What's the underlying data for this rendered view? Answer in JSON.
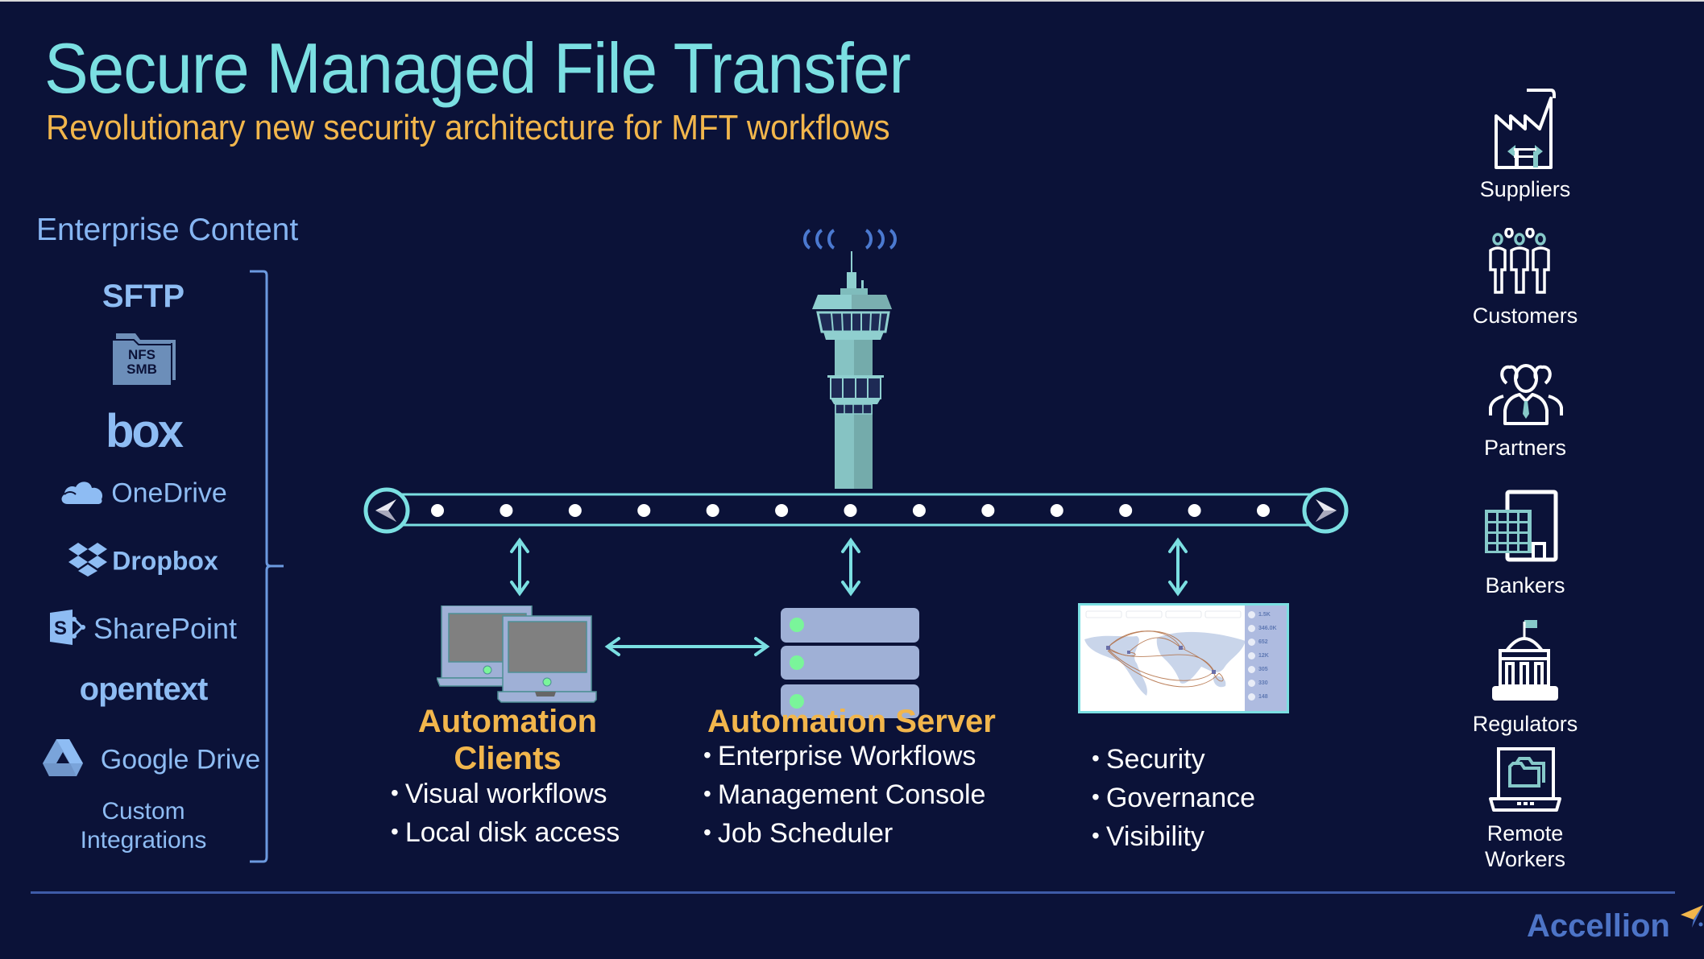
{
  "header": {
    "title": "Secure Managed File Transfer",
    "subtitle": "Revolutionary new security architecture for MFT workflows"
  },
  "enterprise_content": {
    "heading": "Enterprise Content",
    "items": [
      {
        "label": "SFTP",
        "icon": "text-logo"
      },
      {
        "label": "NFS\nSMB",
        "line1": "NFS",
        "line2": "SMB",
        "icon": "folder-icon"
      },
      {
        "label": "box",
        "icon": "box-logo"
      },
      {
        "label": "OneDrive",
        "icon": "cloud-icon"
      },
      {
        "label": "Dropbox",
        "icon": "dropbox-icon"
      },
      {
        "label": "SharePoint",
        "icon": "sharepoint-icon"
      },
      {
        "label": "opentext",
        "icon": "text-logo"
      },
      {
        "label": "Google Drive",
        "icon": "google-drive-icon"
      },
      {
        "label": "Custom",
        "label2": "Integrations",
        "icon": "none"
      }
    ]
  },
  "center": {
    "tower_icon": "control-tower-icon",
    "bus_icon": "data-bus",
    "bus_dot_count": 13,
    "components": [
      {
        "title_line1": "Automation",
        "title_line2": "Clients",
        "icon": "laptops-icon",
        "bullets": [
          "Visual workflows",
          "Local disk access"
        ]
      },
      {
        "title_line1": "Automation Server",
        "icon": "server-stack-icon",
        "bullets": [
          "Enterprise Workflows",
          "Management Console",
          "Job Scheduler"
        ]
      },
      {
        "icon": "dashboard-map-icon",
        "bullets": [
          "Security",
          "Governance",
          "Visibility"
        ],
        "dashboard_stats": [
          "1.5K",
          "346.0K",
          "652",
          "12K",
          "305",
          "330",
          "148"
        ]
      }
    ]
  },
  "external_parties": [
    {
      "label": "Suppliers",
      "icon": "factory-icon"
    },
    {
      "label": "Customers",
      "icon": "people-group-icon"
    },
    {
      "label": "Partners",
      "icon": "business-team-icon"
    },
    {
      "label": "Bankers",
      "icon": "bank-building-icon"
    },
    {
      "label": "Regulators",
      "icon": "government-building-icon"
    },
    {
      "label": "Remote",
      "label2": "Workers",
      "icon": "laptop-folder-icon"
    }
  ],
  "footer": {
    "brand": "Accellion"
  },
  "colors": {
    "background": "#0b1238",
    "title": "#7bdfe2",
    "subtitle": "#f2b64c",
    "accent_teal": "#7bdfe2",
    "logo_blue": "#8ebcf3",
    "brand_blue": "#4d74c7",
    "led_green": "#7af59a"
  }
}
